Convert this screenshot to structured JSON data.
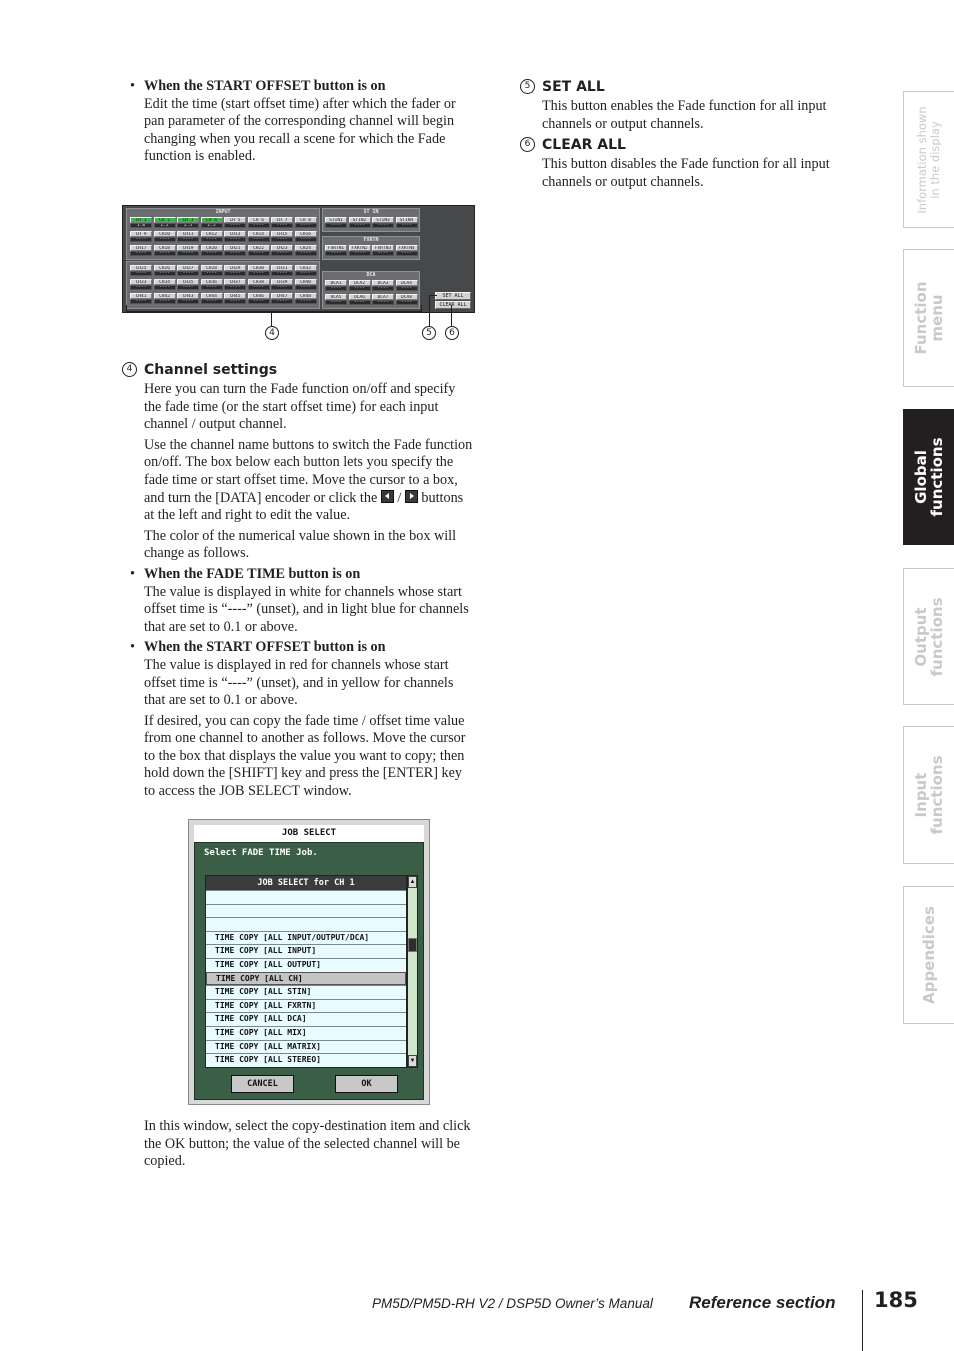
{
  "left_column": {
    "intro_bullet": {
      "heading": "When the START OFFSET button is on",
      "body": "Edit the time (start offset time) after which the fader or pan parameter of the corresponding channel will begin changing when you recall a scene for which the Fade function is enabled."
    },
    "channel_settings": {
      "number": "4",
      "title": "Channel settings",
      "p1": "Here you can turn the Fade function on/off and specify the fade time (or the start offset time) for each input channel / output channel.",
      "p2_before": "Use the channel name buttons to switch the Fade function on/off. The box below each button lets you specify the fade time or start offset time. Move the cursor to a box, and turn the [DATA] encoder or click the",
      "p2_sep": "/",
      "p2_after": "buttons at the left and right to edit the value.",
      "p3": "The color of the numerical value shown in the box will change as follows.",
      "bullets": [
        {
          "heading": "When the FADE TIME button is on",
          "body": "The value is displayed in white for channels whose start offset time is “----” (unset), and in light blue for channels that are set to 0.1 or above."
        },
        {
          "heading": "When the START OFFSET button is on",
          "body": "The value is displayed in red for channels whose start offset time is “----” (unset), and in yellow for channels that are set to 0.1 or above."
        }
      ],
      "p4": "If desired, you can copy the fade time / offset time value from one channel to another as follows. Move the cursor to the box that displays the value you want to copy; then hold down the [SHIFT] key and press the [ENTER] key to access the JOB SELECT window.",
      "p5": "In this window, select the copy-destination item and click the OK button; the value of the selected channel will be copied."
    }
  },
  "right_column": {
    "items": [
      {
        "number": "5",
        "title": "SET ALL",
        "body": "This button enables the Fade function for all input channels or output channels."
      },
      {
        "number": "6",
        "title": "CLEAR ALL",
        "body": "This button disables the Fade function for all input channels or output channels."
      }
    ]
  },
  "channel_screen": {
    "input_title": "INPUT",
    "input_channels_a": [
      {
        "name": "CH 1",
        "value": "1.0",
        "on": true
      },
      {
        "name": "CH 2",
        "value": "1.2",
        "on": true
      },
      {
        "name": "CH 3",
        "value": "2.5",
        "on": true
      },
      {
        "name": "CH 4",
        "value": "2.5",
        "on": true
      },
      {
        "name": "CH 5",
        "value": "----",
        "on": false
      },
      {
        "name": "CH 6",
        "value": "----",
        "on": false
      },
      {
        "name": "CH 7",
        "value": "----",
        "on": false
      },
      {
        "name": "CH 8",
        "value": "----",
        "on": false
      },
      {
        "name": "CH 9",
        "value": "----",
        "on": false
      },
      {
        "name": "CH10",
        "value": "----",
        "on": false
      },
      {
        "name": "CH11",
        "value": "----",
        "on": false
      },
      {
        "name": "CH12",
        "value": "----",
        "on": false
      },
      {
        "name": "CH13",
        "value": "----",
        "on": false
      },
      {
        "name": "CH14",
        "value": "----",
        "on": false
      },
      {
        "name": "CH15",
        "value": "----",
        "on": false
      },
      {
        "name": "CH16",
        "value": "----",
        "on": false
      },
      {
        "name": "CH17",
        "value": "----",
        "on": false
      },
      {
        "name": "CH18",
        "value": "----",
        "on": false
      },
      {
        "name": "CH19",
        "value": "----",
        "on": false
      },
      {
        "name": "CH20",
        "value": "----",
        "on": false
      },
      {
        "name": "CH21",
        "value": "----",
        "on": false
      },
      {
        "name": "CH22",
        "value": "----",
        "on": false
      },
      {
        "name": "CH23",
        "value": "----",
        "on": false
      },
      {
        "name": "CH24",
        "value": "----",
        "on": false
      }
    ],
    "input_channels_b": [
      {
        "name": "CH25",
        "value": "----"
      },
      {
        "name": "CH26",
        "value": "----"
      },
      {
        "name": "CH27",
        "value": "----"
      },
      {
        "name": "CH28",
        "value": "----"
      },
      {
        "name": "CH29",
        "value": "----"
      },
      {
        "name": "CH30",
        "value": "----"
      },
      {
        "name": "CH31",
        "value": "----"
      },
      {
        "name": "CH32",
        "value": "----"
      },
      {
        "name": "CH33",
        "value": "----"
      },
      {
        "name": "CH34",
        "value": "----"
      },
      {
        "name": "CH35",
        "value": "----"
      },
      {
        "name": "CH36",
        "value": "----"
      },
      {
        "name": "CH37",
        "value": "----"
      },
      {
        "name": "CH38",
        "value": "----"
      },
      {
        "name": "CH39",
        "value": "----"
      },
      {
        "name": "CH40",
        "value": "----"
      },
      {
        "name": "CH41",
        "value": "----"
      },
      {
        "name": "CH42",
        "value": "----"
      },
      {
        "name": "CH43",
        "value": "----"
      },
      {
        "name": "CH44",
        "value": "----"
      },
      {
        "name": "CH45",
        "value": "----"
      },
      {
        "name": "CH46",
        "value": "----"
      },
      {
        "name": "CH47",
        "value": "----"
      },
      {
        "name": "CH48",
        "value": "----"
      }
    ],
    "stin_title": "ST IN",
    "stin": [
      {
        "name": "STIN1",
        "value": "----"
      },
      {
        "name": "STIN2",
        "value": "----"
      },
      {
        "name": "STIN3",
        "value": "----"
      },
      {
        "name": "STIN4",
        "value": "----"
      }
    ],
    "fxrtn_title": "FXRTN",
    "fxrtn": [
      {
        "name": "FXRTN1",
        "value": "----"
      },
      {
        "name": "FXRTN2",
        "value": "----"
      },
      {
        "name": "FXRTN3",
        "value": "----"
      },
      {
        "name": "FXRTN4",
        "value": "----"
      }
    ],
    "dca_title": "DCA",
    "dca": [
      {
        "name": "DCA1",
        "value": "----"
      },
      {
        "name": "DCA2",
        "value": "----"
      },
      {
        "name": "DCA3",
        "value": "----"
      },
      {
        "name": "DCA4",
        "value": "----"
      },
      {
        "name": "DCA5",
        "value": "----"
      },
      {
        "name": "DCA6",
        "value": "----"
      },
      {
        "name": "DCA7",
        "value": "----"
      },
      {
        "name": "DCA8",
        "value": "----"
      }
    ],
    "set_all_label": "SET ALL",
    "clear_all_label": "CLEAR ALL",
    "callouts": [
      "4",
      "5",
      "6"
    ],
    "colors": {
      "on_green": "#3fb34f",
      "panel": "#47484a",
      "group": "#6b6d70"
    }
  },
  "job_select": {
    "title": "JOB SELECT",
    "prompt": "Select FADE TIME Job.",
    "list_header": "JOB SELECT for CH 1",
    "rows": [
      "",
      "",
      "",
      "TIME COPY [ALL INPUT/OUTPUT/DCA]",
      "TIME COPY [ALL INPUT]",
      "TIME COPY [ALL OUTPUT]",
      "TIME COPY [ALL CH]",
      "TIME COPY [ALL STIN]",
      "TIME COPY [ALL FXRTN]",
      "TIME COPY [ALL DCA]",
      "TIME COPY [ALL MIX]",
      "TIME COPY [ALL MATRIX]",
      "TIME COPY [ALL STEREO]"
    ],
    "selected_index": 6,
    "cancel_label": "CANCEL",
    "ok_label": "OK",
    "colors": {
      "window_bg": "#3a5e46",
      "list_bg": "#e8fbff",
      "scrollbar": "#cfe8cc"
    }
  },
  "side_tabs": [
    {
      "line1": "Information shown",
      "line2": "in the display",
      "active": false
    },
    {
      "line1": "Function",
      "line2": "menu",
      "active": false
    },
    {
      "line1": "Global",
      "line2": "functions",
      "active": true
    },
    {
      "line1": "Output",
      "line2": "functions",
      "active": false
    },
    {
      "line1": "Input",
      "line2": "functions",
      "active": false
    },
    {
      "line1": "Appendices",
      "line2": "",
      "active": false
    }
  ],
  "footer": {
    "manual": "PM5D/PM5D-RH V2 / DSP5D Owner’s Manual",
    "section": "Reference section",
    "page": "185"
  }
}
